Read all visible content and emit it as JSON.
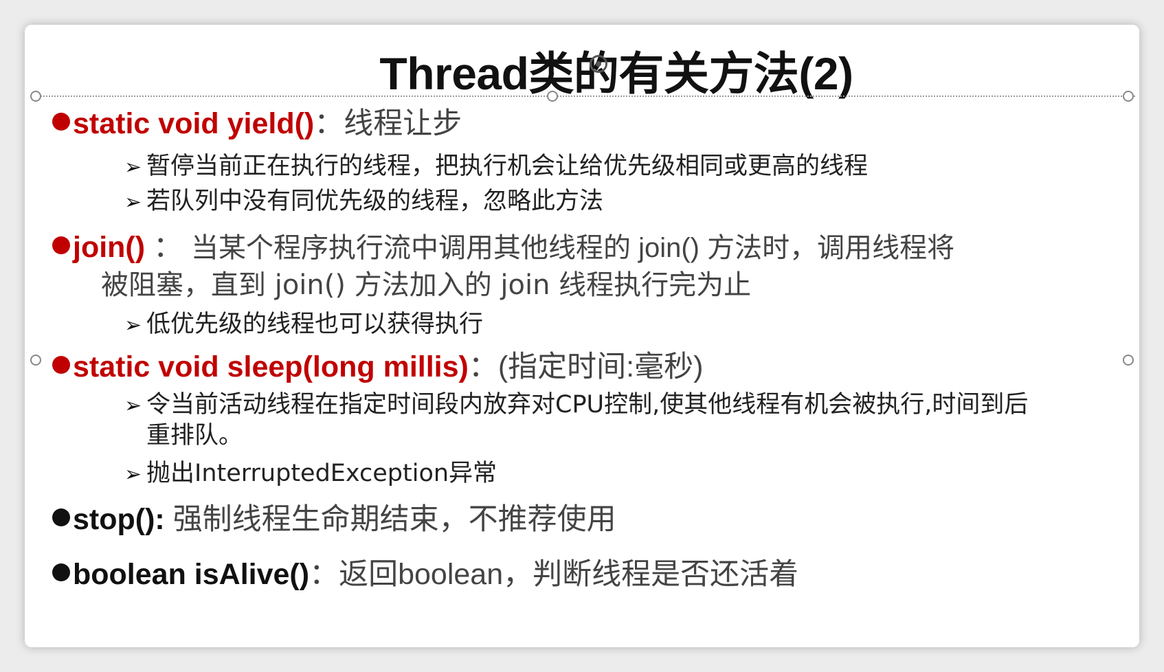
{
  "slide": {
    "title": "Thread类的有关方法(2)",
    "items": [
      {
        "keyword": "static  void  yield()",
        "separator": "：",
        "description": "线程让步",
        "subs": [
          "暂停当前正在执行的线程，把执行机会让给优先级相同或更高的线程",
          "若队列中没有同优先级的线程，忽略此方法"
        ]
      },
      {
        "keyword": "join()",
        "separator": " ： ",
        "description": "当某个程序执行流中调用其他线程的 join() 方法时，调用线程将",
        "continuation": "被阻塞，直到 join() 方法加入的 join 线程执行完为止",
        "subs": [
          "低优先级的线程也可以获得执行"
        ]
      },
      {
        "keyword": "static  void  sleep(long millis)",
        "separator": "：",
        "description": "(指定时间:毫秒)",
        "subs": [
          "令当前活动线程在指定时间段内放弃对CPU控制,使其他线程有机会被执行,时间到后",
          "抛出InterruptedException异常"
        ],
        "sub_continuation": "重排队。"
      },
      {
        "keyword": "stop():",
        "separator": " ",
        "description": "强制线程生命期结束，不推荐使用"
      },
      {
        "keyword": "boolean isAlive()",
        "separator": "：",
        "description": "返回boolean，判断线程是否还活着"
      }
    ]
  },
  "icons": {
    "bullet": "filled-circle-bullet",
    "sub_bullet": "arrow-bullet",
    "cursor": "rotate-handle-icon"
  },
  "colors": {
    "keyword_red": "#c00000",
    "keyword_black": "#111111"
  }
}
